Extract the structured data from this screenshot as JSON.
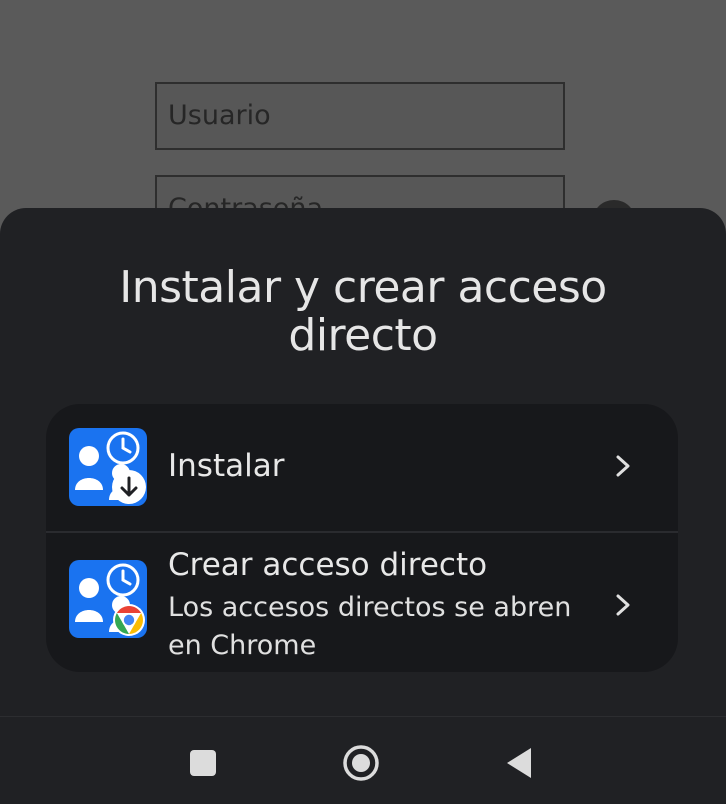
{
  "background": {
    "username_placeholder": "Usuario",
    "password_placeholder": "Contraseña"
  },
  "sheet": {
    "title": "Instalar y crear acceso directo",
    "options": [
      {
        "label": "Instalar",
        "icon": "app-icon-download-badge"
      },
      {
        "label": "Crear acceso directo",
        "subtitle": "Los accesos directos se abren en Chrome",
        "icon": "app-icon-chrome-badge"
      }
    ]
  },
  "navbar": {
    "recents": "recents-icon",
    "home": "home-icon",
    "back": "back-icon"
  },
  "colors": {
    "sheet_background": "#202124",
    "card_background": "#17181b",
    "app_icon_blue": "#1a73f0",
    "dim_overlay": "#5a5a5a"
  }
}
